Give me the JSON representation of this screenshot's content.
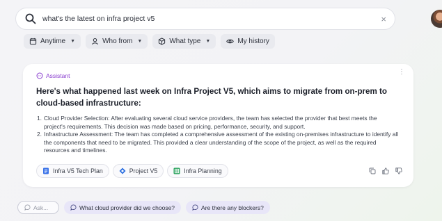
{
  "search": {
    "query": "what's the latest on infra project v5",
    "clear_label": "×"
  },
  "filters": [
    {
      "label": "Anytime",
      "icon": "calendar-icon"
    },
    {
      "label": "Who from",
      "icon": "person-icon"
    },
    {
      "label": "What type",
      "icon": "cube-icon"
    },
    {
      "label": "My history",
      "icon": "eye-icon"
    }
  ],
  "answer": {
    "tag": "Assistant",
    "more_label": "⋮",
    "headline": "Here's what happened last week on Infra Project V5, which aims to migrate from on-prem to cloud-based infrastructure:",
    "items": [
      {
        "num": "1.",
        "text": "Cloud Provider Selection: After evaluating several cloud service providers, the team has selected the provider that best meets the project's requirements. This decision was made based on pricing, performance, security, and support."
      },
      {
        "num": "2.",
        "text": "Infrastructure Assessment: The team has completed a comprehensive assessment of the existing on-premises infrastructure to identify all the components that need to be migrated. This provided a clear understanding of the scope of the project, as well as the required resources and timelines."
      }
    ],
    "sources": [
      {
        "label": "Infra V5 Tech Plan",
        "icon": "doc-icon",
        "color": "#3b73e8"
      },
      {
        "label": "Project V5",
        "icon": "diamond-icon",
        "color": "#2b6fe0"
      },
      {
        "label": "Infra Planning",
        "icon": "sheet-icon",
        "color": "#1f9e55"
      }
    ]
  },
  "followups": {
    "ask_placeholder": "Ask...",
    "suggestions": [
      "What cloud provider did we choose?",
      "Are there any blockers?"
    ]
  },
  "colors": {
    "accent": "#8a3ecf",
    "chip_bg": "#e9eaef",
    "followup_bg": "#e8e6f8"
  }
}
